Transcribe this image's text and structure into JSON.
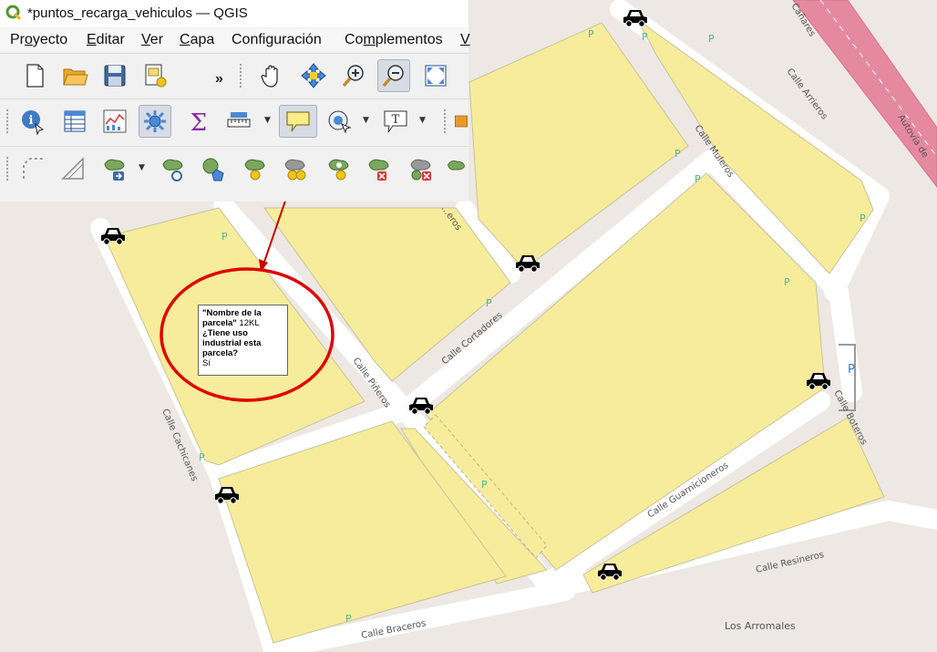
{
  "window": {
    "title": "*puntos_recarga_vehiculos — QGIS"
  },
  "menu": [
    {
      "label": "Proyecto",
      "underline": "o"
    },
    {
      "label": "Editar",
      "underline": "E"
    },
    {
      "label": "Ver",
      "underline": "V"
    },
    {
      "label": "Capa",
      "underline": "C"
    },
    {
      "label": "Configuración",
      "underline": ""
    },
    {
      "label": "Complementos",
      "underline": "m"
    },
    {
      "label": "V",
      "underline": "V"
    }
  ],
  "toolbar1": {
    "icons": [
      "new-project-icon",
      "open-project-icon",
      "save-project-icon",
      "new-print-layout-icon",
      "pan-hand-icon",
      "pan-to-selection-icon",
      "zoom-in-icon",
      "zoom-out-icon",
      "zoom-full-icon"
    ],
    "overflow_label": "»"
  },
  "toolbar2": {
    "icons": [
      "identify-features-icon",
      "open-attribute-table-icon",
      "statistical-summary-icon",
      "map-tips-icon",
      "field-calculator-icon",
      "measure-icon",
      "map-tip-balloon-icon",
      "select-feature-icon",
      "text-annotation-icon",
      "layer-style-icon"
    ]
  },
  "toolbar3": {
    "icons": [
      "digitize-icon",
      "snapping-icon",
      "move-feature-icon",
      "rotate-feature-icon",
      "simplify-feature-icon",
      "add-ring-icon",
      "add-part-icon",
      "fill-ring-icon",
      "delete-ring-icon",
      "delete-part-icon",
      "reshape-icon",
      "offset-curve-icon"
    ]
  },
  "map": {
    "streets": [
      "Calle Arrieros",
      "Calle Muleros",
      "Calle Cortadores",
      "Calle Piñeros",
      "Calle Cachicanes",
      "Calle Boteros",
      "Calle Guarnicioneros",
      "Calle Resineros",
      "Calle Braceros",
      "Autovía de",
      "Cañares",
      "Calle Arrieros"
    ],
    "street_labels": {
      "arrieros": "Calle Arrieros",
      "muleros": "Calle Muleros",
      "cortadores": "Calle Cortadores",
      "pineros": "Calle Piñeros",
      "cachicanes": "Calle Cachicanes",
      "boteros": "Calle Boteros",
      "guarnicioneros": "Calle Guarnicioneros",
      "resineros": "Calle Resineros",
      "braceros": "Calle Braceros",
      "autovia": "Autovía de",
      "canares": "Cañares",
      "meros_partial": "...eros"
    },
    "place_label": "Los Arromales",
    "parking_label": "P",
    "parking_blue_label": "P",
    "charging_point_icon": "car-icon",
    "colors": {
      "parcel": "#f6ec9c",
      "road": "#ffffff",
      "highway": "#e58a9e",
      "background": "#ede8e3",
      "annotation": "#e00000"
    }
  },
  "map_tip": {
    "field1_name": "\"Nombre de la parcela\"",
    "field1_value": " 12KL",
    "field2_name": "¿Tiene uso industrial esta parcela?",
    "field2_value": "Sí"
  }
}
